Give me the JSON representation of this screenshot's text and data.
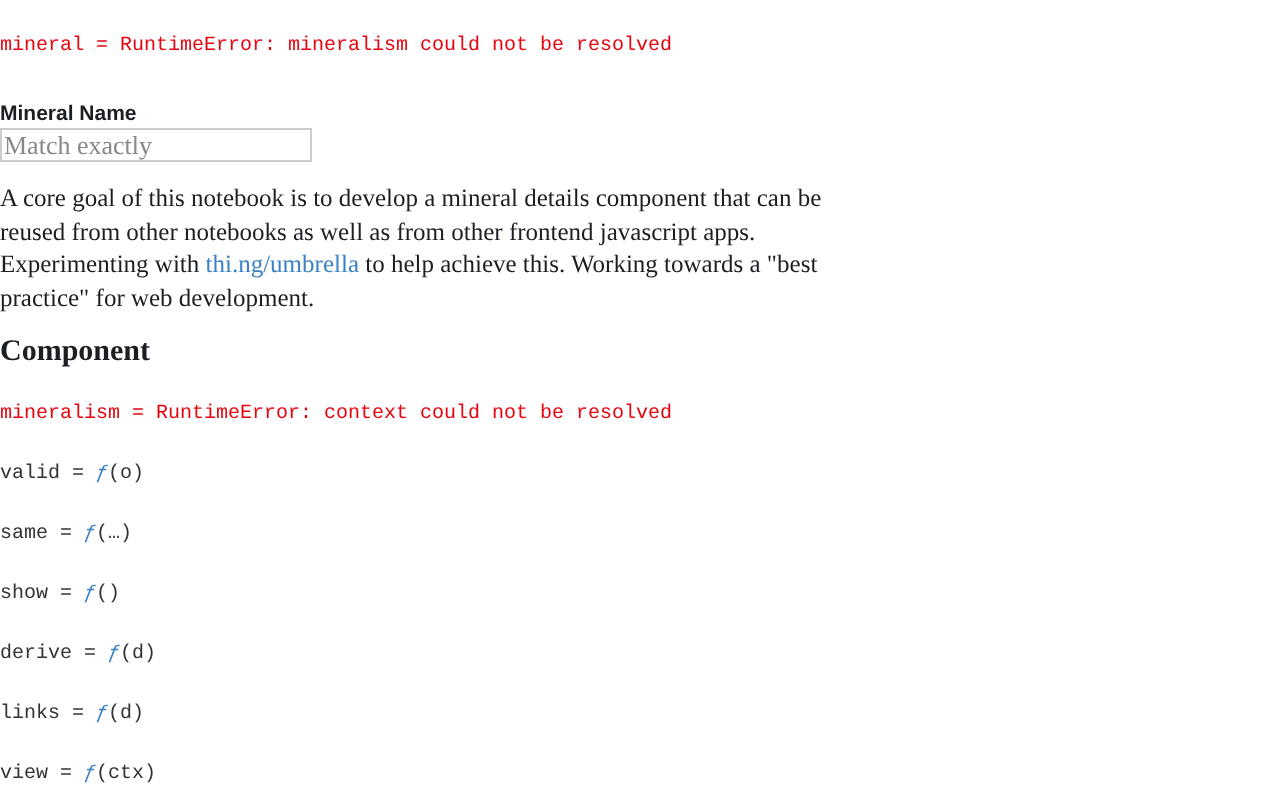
{
  "top_cell": {
    "kind": "error",
    "text": "mineral = RuntimeError: mineralism could not be resolved"
  },
  "field": {
    "label": "Mineral Name",
    "placeholder": "Match exactly"
  },
  "paragraph": {
    "before": "A core goal of this notebook is to develop a mineral details component that can be reused from other notebooks as well as from other frontend javascript apps. Experimenting with",
    "link": "thi.ng/umbrella",
    "after": "to help achieve this. Working towards a \"best practice\" for web development."
  },
  "heading": "Component",
  "cells": [
    {
      "kind": "error",
      "text": "mineralism = RuntimeError: context could not be resolved"
    },
    {
      "kind": "function",
      "name": "valid = ",
      "f": "ƒ",
      "args": "(o)"
    },
    {
      "kind": "function",
      "name": "same = ",
      "f": "ƒ",
      "args": "(…)"
    },
    {
      "kind": "function",
      "name": "show = ",
      "f": "ƒ",
      "args": "()"
    },
    {
      "kind": "function",
      "name": "derive = ",
      "f": "ƒ",
      "args": "(d)"
    },
    {
      "kind": "function",
      "name": "links = ",
      "f": "ƒ",
      "args": "(d)"
    },
    {
      "kind": "function",
      "name": "view = ",
      "f": "ƒ",
      "args": "(ctx)"
    }
  ]
}
